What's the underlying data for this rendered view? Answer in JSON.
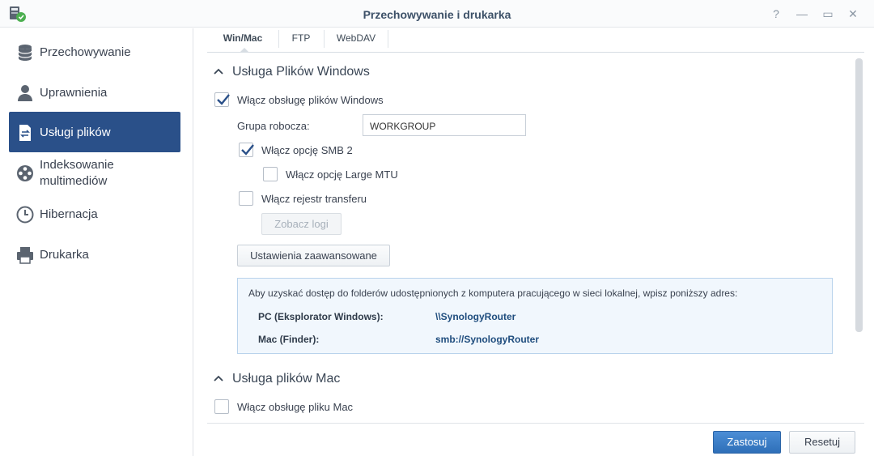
{
  "window": {
    "title": "Przechowywanie i drukarka",
    "help_label": "?",
    "minimize_label": "—",
    "maximize_label": "▭",
    "close_label": "✕"
  },
  "sidebar": {
    "items": [
      {
        "label": "Przechowywanie",
        "icon": "database-icon",
        "active": false
      },
      {
        "label": "Uprawnienia",
        "icon": "user-icon",
        "active": false
      },
      {
        "label": "Usługi plików",
        "icon": "file-transfer-icon",
        "active": true
      },
      {
        "label_line1": "Indeksowanie",
        "label_line2": "multimediów",
        "icon": "film-reel-icon",
        "active": false
      },
      {
        "label": "Hibernacja",
        "icon": "clock-icon",
        "active": false
      },
      {
        "label": "Drukarka",
        "icon": "printer-icon",
        "active": false
      }
    ]
  },
  "tabs": [
    {
      "label": "Win/Mac",
      "active": true
    },
    {
      "label": "FTP",
      "active": false
    },
    {
      "label": "WebDAV",
      "active": false
    }
  ],
  "windows_section": {
    "title": "Usługa Plików Windows",
    "enable_label": "Włącz obsługę plików Windows",
    "enable_checked": true,
    "workgroup_label": "Grupa robocza:",
    "workgroup_value": "WORKGROUP",
    "smb2_label": "Włącz opcję SMB 2",
    "smb2_checked": true,
    "large_mtu_label": "Włącz opcję Large MTU",
    "large_mtu_checked": false,
    "transfer_log_label": "Włącz rejestr transferu",
    "transfer_log_checked": false,
    "view_logs_button": "Zobacz logi",
    "advanced_button": "Ustawienia zaawansowane",
    "info": {
      "text": "Aby uzyskać dostęp do folderów udostępnionych z komputera pracującego w sieci lokalnej, wpisz poniższy adres:",
      "pc_label": "PC (Eksplorator Windows):",
      "pc_value": "\\\\SynologyRouter",
      "mac_label": "Mac (Finder):",
      "mac_value": "smb://SynologyRouter"
    }
  },
  "mac_section": {
    "title": "Usługa plików Mac",
    "enable_label": "Włącz obsługę pliku Mac",
    "enable_checked": false
  },
  "footer": {
    "apply_label": "Zastosuj",
    "reset_label": "Resetuj"
  },
  "colors": {
    "accent": "#2a5089",
    "apply_button": "#3a7cc6",
    "checkmark": "#2a5089"
  }
}
